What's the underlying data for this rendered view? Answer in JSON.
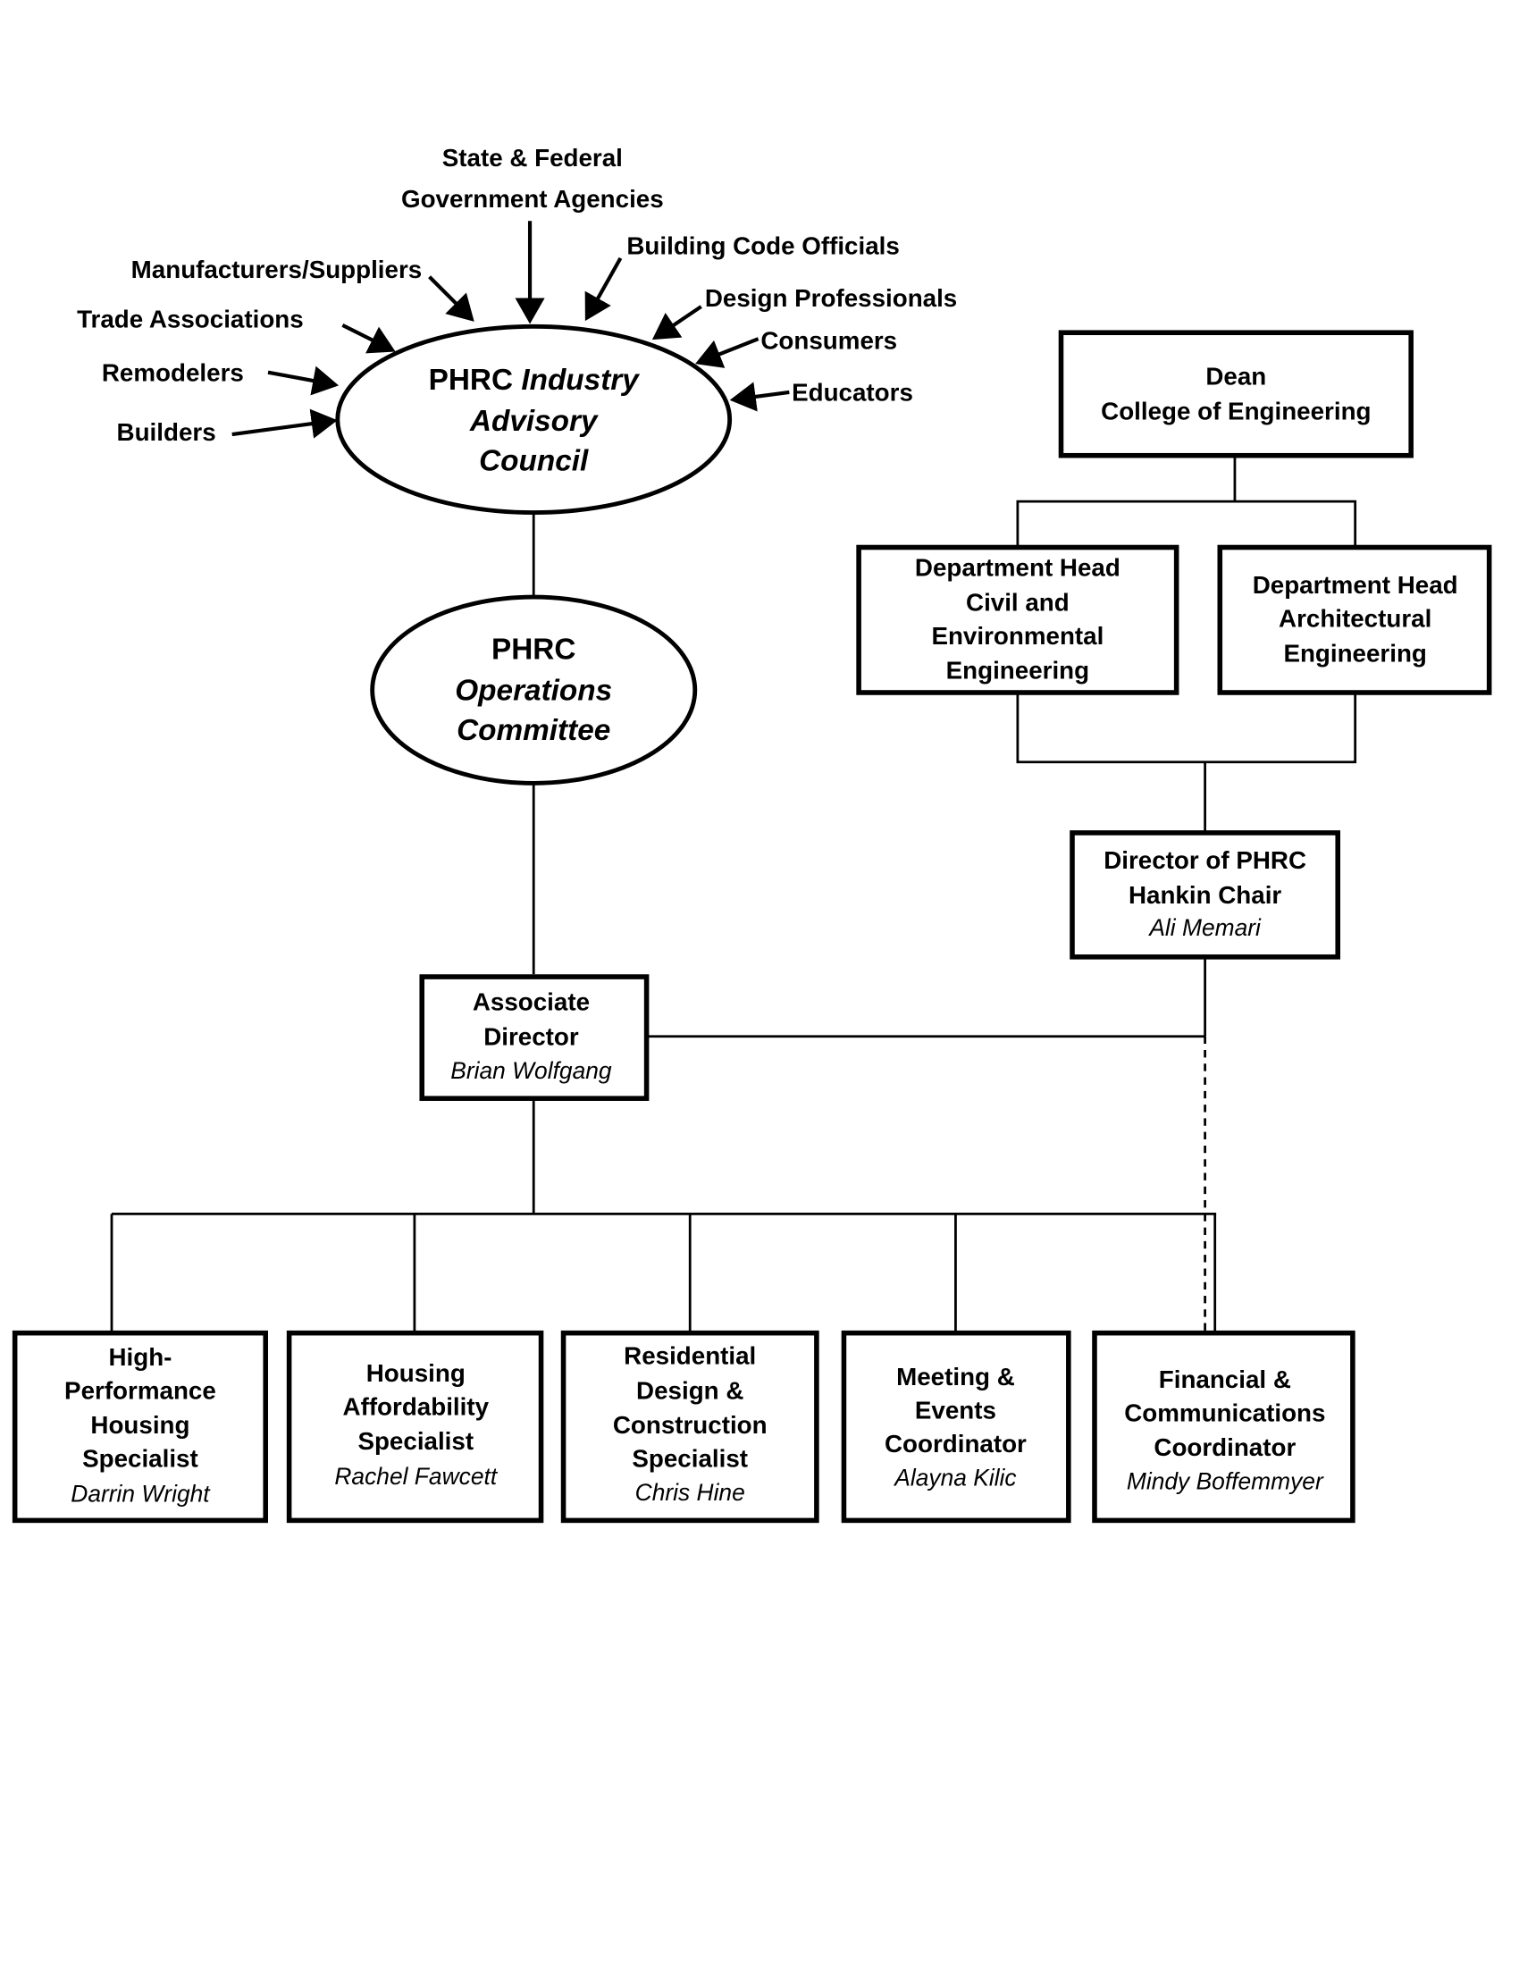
{
  "stakeholders": {
    "state_federal": [
      "State & Federal",
      "Government Agencies"
    ],
    "building_code": "Building Code Officials",
    "manufacturers": "Manufacturers/Suppliers",
    "trade": "Trade Associations",
    "remodelers": "Remodelers",
    "builders": "Builders",
    "design": "Design Professionals",
    "consumers": "Consumers",
    "educators": "Educators"
  },
  "advisory_council": {
    "line1_a": "PHRC",
    "line1_b": "Industry",
    "line2": "Advisory",
    "line3": "Council"
  },
  "operations": {
    "line1": "PHRC",
    "line2": "Operations",
    "line3": "Committee"
  },
  "dean": [
    "Dean",
    "College of Engineering"
  ],
  "dept_civil": [
    "Department Head",
    "Civil and",
    "Environmental",
    "Engineering"
  ],
  "dept_arch": [
    "Department Head",
    "Architectural",
    "Engineering"
  ],
  "director": {
    "title": [
      "Director of PHRC",
      "Hankin Chair"
    ],
    "name": "Ali Memari"
  },
  "associate": {
    "title": [
      "Associate",
      "Director"
    ],
    "name": "Brian Wolfgang"
  },
  "staff": [
    {
      "title": [
        "High-",
        "Performance",
        "Housing",
        "Specialist"
      ],
      "name": "Darrin Wright"
    },
    {
      "title": [
        "Housing",
        "Affordability",
        "Specialist"
      ],
      "name": "Rachel Fawcett"
    },
    {
      "title": [
        "Residential",
        "Design &",
        "Construction",
        "Specialist"
      ],
      "name": "Chris Hine"
    },
    {
      "title": [
        "Meeting &",
        "Events",
        "Coordinator"
      ],
      "name": "Alayna Kilic"
    },
    {
      "title": [
        "Financial &",
        "Communications",
        "Coordinator"
      ],
      "name": "Mindy Boffemmyer"
    }
  ]
}
